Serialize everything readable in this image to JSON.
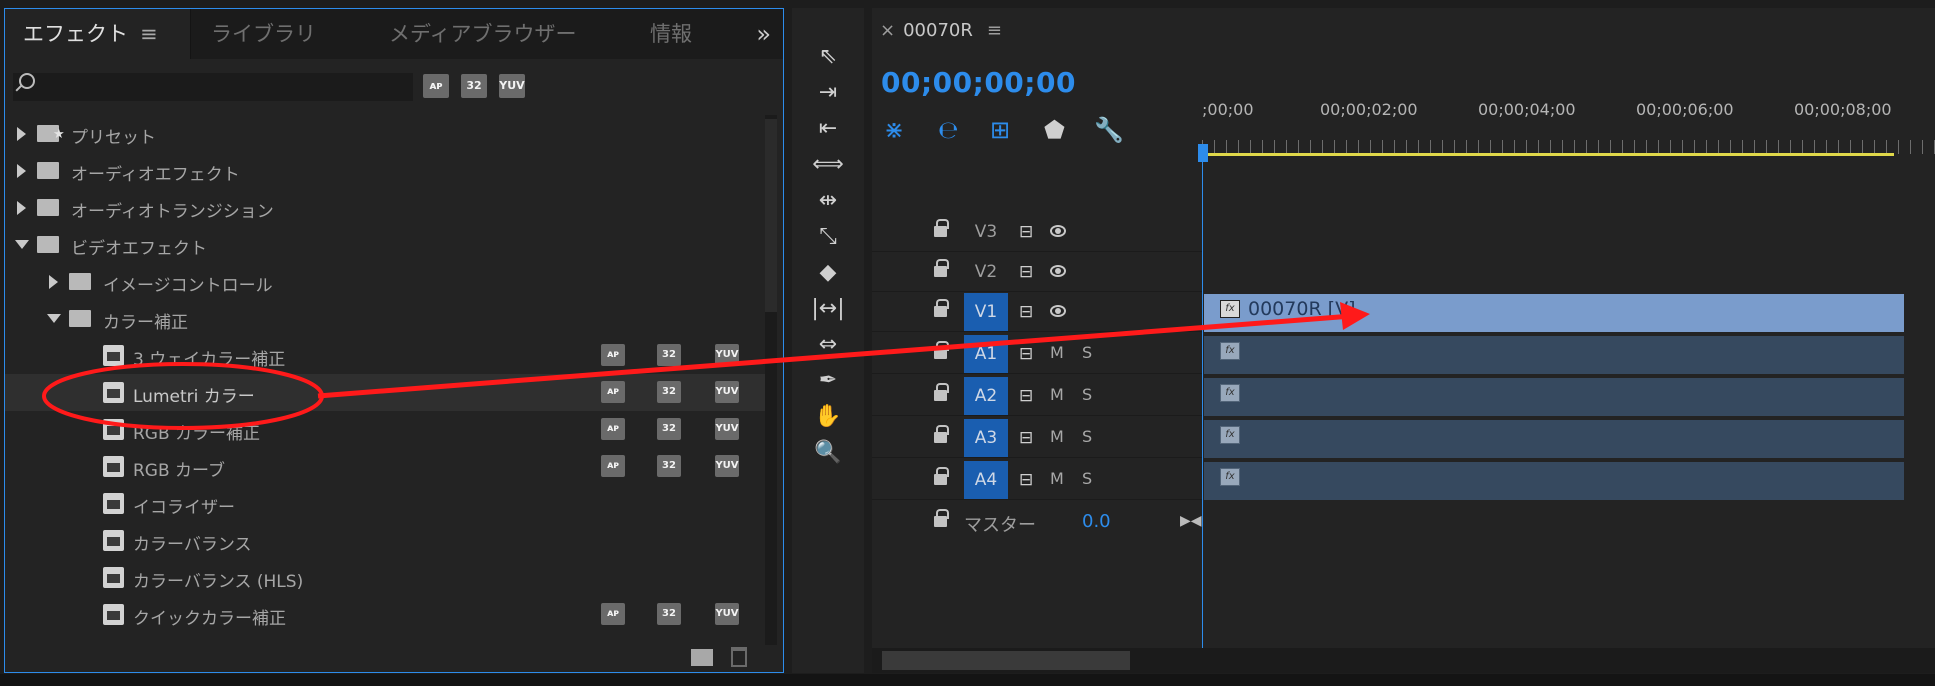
{
  "effects_panel": {
    "tabs": [
      {
        "label": "エフェクト",
        "menu": "≡",
        "active": true
      },
      {
        "label": "ライブラリ"
      },
      {
        "label": "メディアブラウザー"
      },
      {
        "label": "情報"
      }
    ],
    "overflow_label": "»",
    "search": {
      "value": "",
      "placeholder": ""
    },
    "filter_flags": [
      "ᴀᴘ",
      "32",
      "YUV"
    ],
    "tree": [
      {
        "label": "プリセット",
        "expanded": false
      },
      {
        "label": "オーディオエフェクト",
        "expanded": false
      },
      {
        "label": "オーディオトランジション",
        "expanded": false
      },
      {
        "label": "ビデオエフェクト",
        "expanded": true
      },
      {
        "label": "イメージコントロール",
        "expanded": false
      },
      {
        "label": "カラー補正",
        "expanded": true
      },
      {
        "label": "3 ウェイカラー補正",
        "flags": true
      },
      {
        "label": "Lumetri カラー",
        "flags": true,
        "selected": true
      },
      {
        "label": "RGB カラー補正",
        "flags": true
      },
      {
        "label": "RGB カーブ",
        "flags": true
      },
      {
        "label": "イコライザー"
      },
      {
        "label": "カラーバランス"
      },
      {
        "label": "カラーバランス (HLS)"
      },
      {
        "label": "クイックカラー補正",
        "flags": true
      }
    ]
  },
  "tools": [
    "selection-tool",
    "track-select-forward-tool",
    "track-select-backward-tool",
    "ripple-edit-tool",
    "rolling-edit-tool",
    "rate-stretch-tool",
    "razor-tool",
    "slip-tool",
    "slide-tool",
    "pen-tool",
    "hand-tool",
    "zoom-tool"
  ],
  "timeline": {
    "sequence_tab": {
      "close": "×",
      "name": "00070R",
      "menu": "≡"
    },
    "timecode": "00;00;00;00",
    "ruler_labels": [
      ";00;00",
      "00;00;02;00",
      "00;00;04;00",
      "00;00;06;00",
      "00;00;08;00"
    ],
    "video_tracks": [
      {
        "name": "V3"
      },
      {
        "name": "V2"
      },
      {
        "name": "V1",
        "targeted": true,
        "clip": "00070R [V]"
      }
    ],
    "audio_tracks": [
      {
        "name": "A1",
        "m": "M",
        "s": "S"
      },
      {
        "name": "A2",
        "m": "M",
        "s": "S"
      },
      {
        "name": "A3",
        "m": "M",
        "s": "S"
      },
      {
        "name": "A4",
        "m": "M",
        "s": "S"
      }
    ],
    "master": {
      "label": "マスター",
      "value": "0.0"
    },
    "fx_badge": "fx"
  },
  "annotation": {
    "color": "#ff1a1a"
  }
}
